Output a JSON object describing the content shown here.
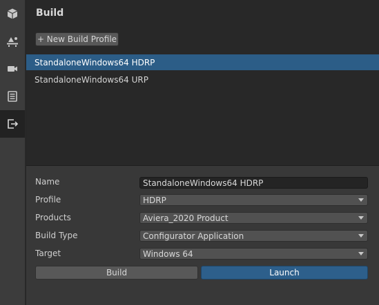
{
  "sidebar": {
    "items": [
      {
        "icon": "cube-icon"
      },
      {
        "icon": "scene-icon"
      },
      {
        "icon": "camera-icon"
      },
      {
        "icon": "list-icon"
      },
      {
        "icon": "export-icon",
        "active": true
      }
    ]
  },
  "header": {
    "title": "Build"
  },
  "toolbar": {
    "new_profile_label": "+ New Build Profile"
  },
  "profiles": [
    {
      "label": "StandaloneWindows64 HDRP",
      "selected": true
    },
    {
      "label": "StandaloneWindows64 URP",
      "selected": false
    }
  ],
  "form": {
    "name_label": "Name",
    "name_value": "StandaloneWindows64 HDRP",
    "profile_label": "Profile",
    "profile_value": "HDRP",
    "products_label": "Products",
    "products_value": "Aviera_2020 Product",
    "build_type_label": "Build Type",
    "build_type_value": "Configurator Application",
    "target_label": "Target",
    "target_value": "Windows 64"
  },
  "actions": {
    "build_label": "Build",
    "launch_label": "Launch"
  },
  "colors": {
    "accent": "#2c5d87",
    "launch": "#2d5f8b",
    "panel": "#383838",
    "sidebar": "#3c3c3c"
  }
}
